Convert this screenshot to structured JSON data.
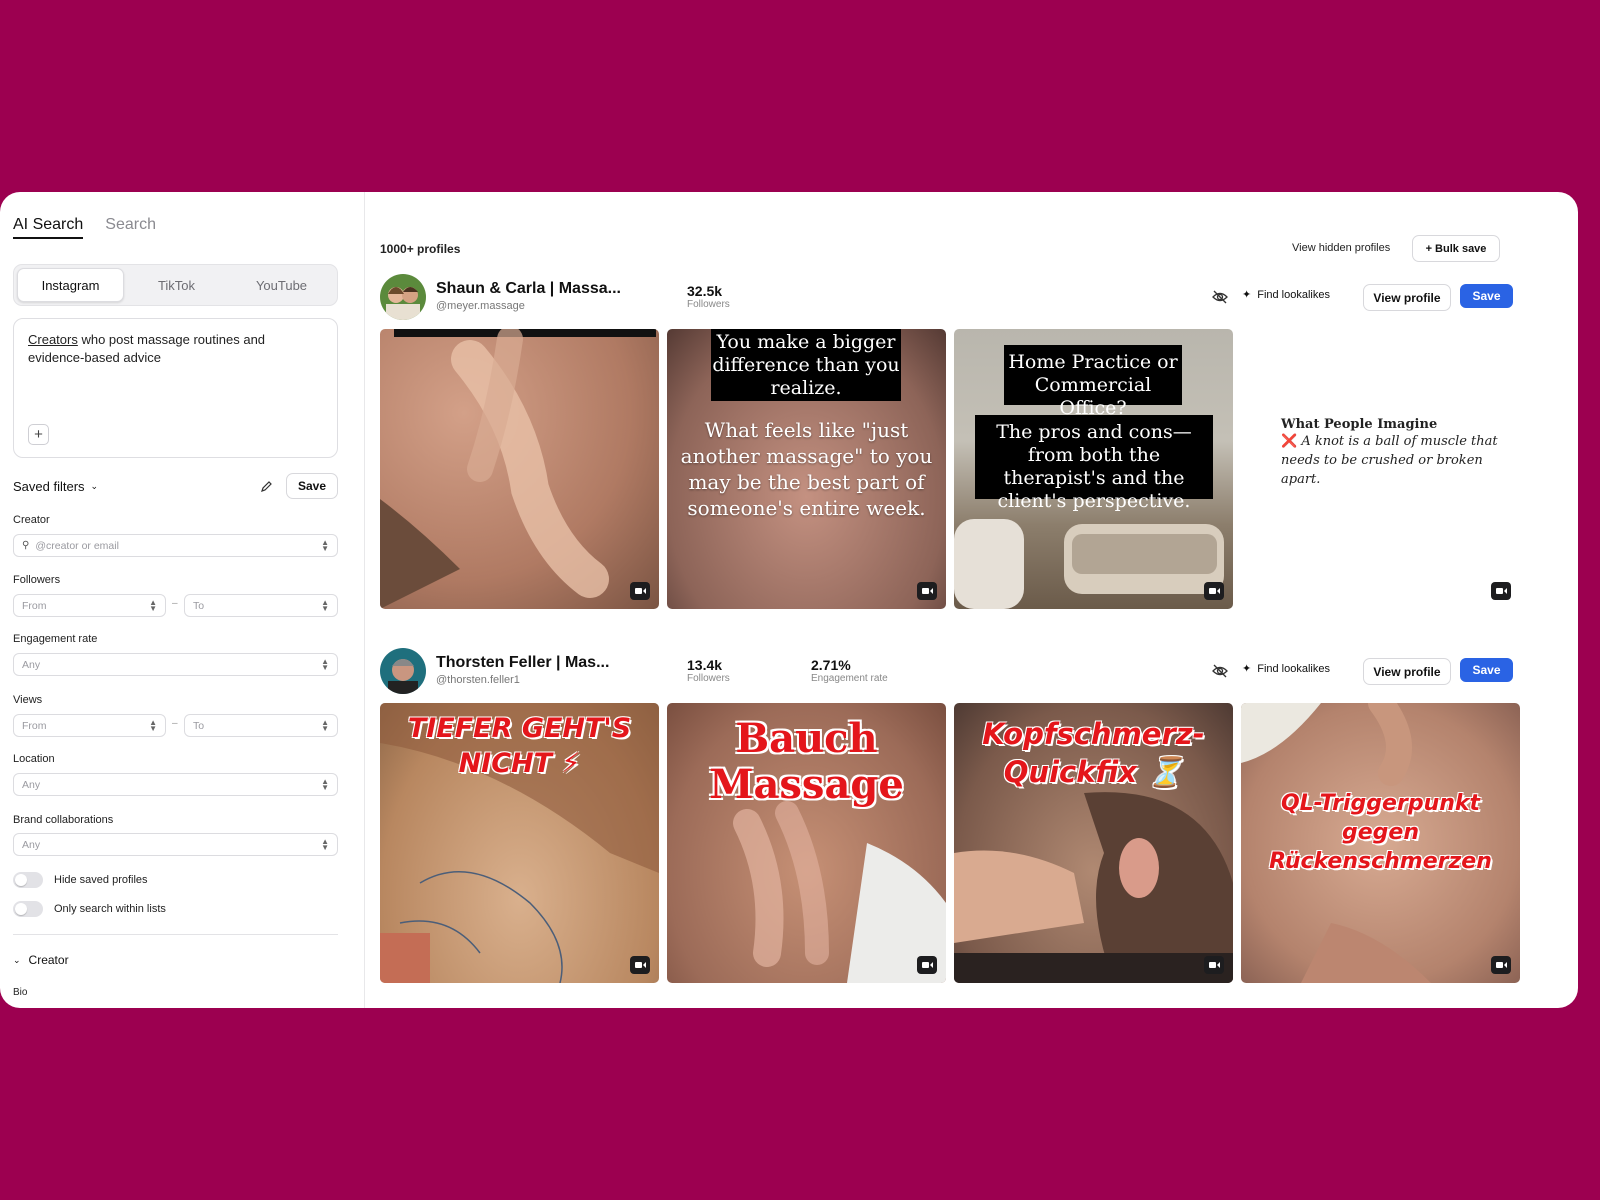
{
  "mode_tabs": [
    "AI Search",
    "Search"
  ],
  "platforms": [
    "Instagram",
    "TikTok",
    "YouTube"
  ],
  "prompt": {
    "highlight": "Creators",
    "rest": " who post massage routines and evidence-based advice",
    "add_label": "+"
  },
  "saved_filters": {
    "title": "Saved filters",
    "save": "Save"
  },
  "filters": {
    "creator": {
      "label": "Creator",
      "placeholder": "@creator or email"
    },
    "followers": {
      "label": "Followers",
      "from": "From",
      "to": "To"
    },
    "engagement": {
      "label": "Engagement rate",
      "value": "Any"
    },
    "views": {
      "label": "Views",
      "from": "From",
      "to": "To"
    },
    "location": {
      "label": "Location",
      "value": "Any"
    },
    "brand": {
      "label": "Brand collaborations",
      "value": "Any"
    },
    "dash": "–"
  },
  "toggles": {
    "hide_saved": "Hide saved profiles",
    "only_lists": "Only search within lists"
  },
  "section": {
    "title": "Creator",
    "sub": "Bio"
  },
  "results": {
    "count": "1000+ profiles",
    "hidden": "View hidden profiles",
    "bulk": "+ Bulk save"
  },
  "actions": {
    "lookalikes": "Find lookalikes",
    "view": "View profile",
    "save": "Save"
  },
  "profiles": [
    {
      "name": "Shaun & Carla | Massa...",
      "handle": "@meyer.massage",
      "followers": "32.5k",
      "followers_label": "Followers",
      "tiles": {
        "t2_box": "You make a bigger difference than you realize.",
        "t2_text": "What feels like \"just another massage\" to you may be the best part of someone's entire week.",
        "t3_box1": "Home Practice or Commercial Office?",
        "t3_box2": "The pros and cons—from both the therapist's and the client's perspective.",
        "t4_head": "What People Imagine",
        "t4_mark": "❌",
        "t4_body": "A knot is a ball of muscle that needs to be crushed or broken apart."
      }
    },
    {
      "name": "Thorsten Feller | Mas...",
      "handle": "@thorsten.feller1",
      "followers": "13.4k",
      "followers_label": "Followers",
      "engagement": "2.71%",
      "engagement_label": "Engagement rate",
      "tiles": {
        "t1": "TIEFER GEHT'S NICHT ⚡",
        "t2a": "Bauch",
        "t2b": "Massage",
        "t3": "Kopfschmerz-Quickfix ⏳",
        "t4": "QL-Triggerpunkt gegen Rückenschmerzen"
      }
    }
  ],
  "colors": {
    "background": "#9c0050",
    "accent": "#2a63e4"
  }
}
